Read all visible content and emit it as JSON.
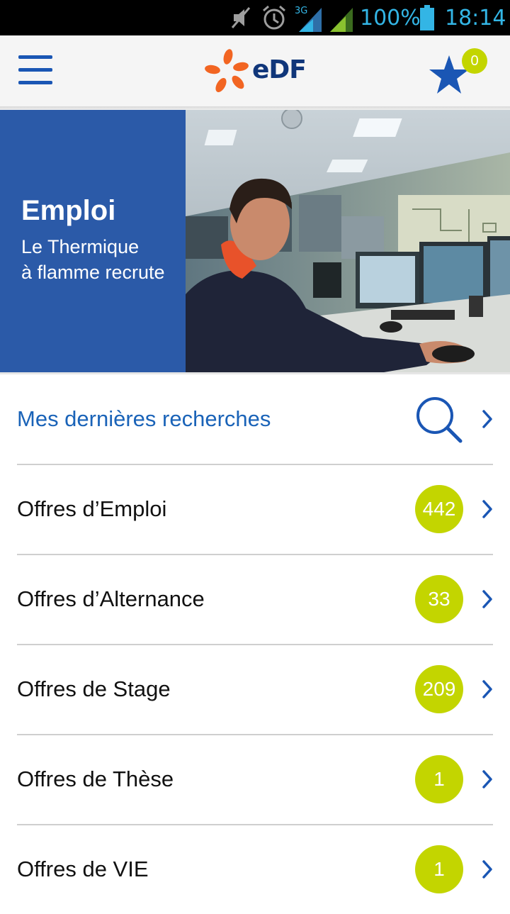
{
  "status_bar": {
    "battery": "100%",
    "time": "18:14",
    "network": "3G",
    "icons": [
      "mute-icon",
      "alarm-icon",
      "signal-3g-icon",
      "signal-icon",
      "battery-icon"
    ]
  },
  "app_bar": {
    "logo_text": "eDF",
    "favorites_count": "0",
    "icons": [
      "hamburger-menu-icon",
      "edf-logo",
      "star-icon"
    ]
  },
  "banner": {
    "title": "Emploi",
    "subtitle_line1": "Le Thermique",
    "subtitle_line2": "à flamme recrute"
  },
  "list": {
    "recent_searches": "Mes dernières recherches",
    "items": [
      {
        "label": "Offres d’Emploi",
        "count": "442"
      },
      {
        "label": "Offres d’Alternance",
        "count": "33"
      },
      {
        "label": "Offres de Stage",
        "count": "209"
      },
      {
        "label": "Offres de Thèse",
        "count": "1"
      },
      {
        "label": "Offres de VIE",
        "count": "1"
      }
    ]
  },
  "colors": {
    "brand_blue": "#1a56b4",
    "banner_blue": "#2b5aa8",
    "badge_green": "#c3d500",
    "status_blue": "#33b5e5",
    "logo_orange": "#f26522"
  }
}
